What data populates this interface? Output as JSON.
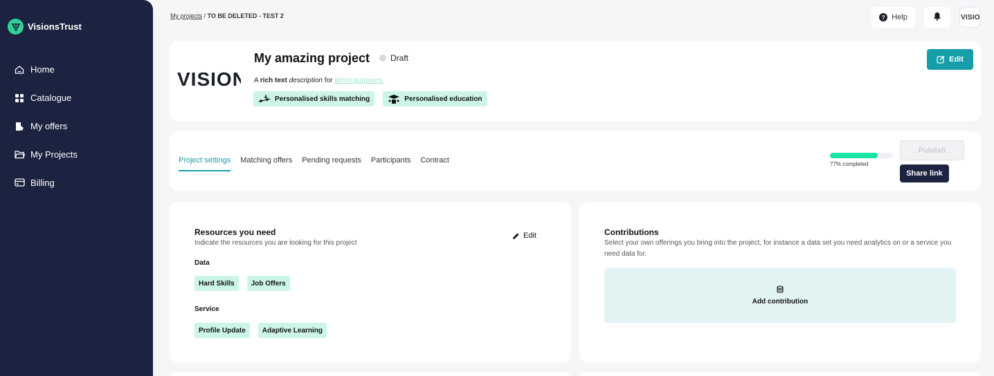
{
  "brand": {
    "name": "VisionsTrust"
  },
  "sidebar": {
    "items": [
      {
        "label": "Home",
        "icon": "home-icon"
      },
      {
        "label": "Catalogue",
        "icon": "grid-icon"
      },
      {
        "label": "My offers",
        "icon": "offers-icon"
      },
      {
        "label": "My Projects",
        "icon": "folder-icon"
      },
      {
        "label": "Billing",
        "icon": "billing-icon"
      }
    ]
  },
  "breadcrumb": {
    "parent": "My projects",
    "separator": "/",
    "current": "TO BE DELETED - TEST 2"
  },
  "topbar": {
    "help_label": "Help",
    "avatar_text": "VISIONS"
  },
  "project": {
    "logo_text": "VISIONS",
    "title": "My amazing project",
    "status": "Draft",
    "description": {
      "part1": "A ",
      "bold": "rich text",
      "italic": "description",
      "part2": " for ",
      "link": "demo purposes."
    },
    "tags": [
      {
        "label": "Personalised skills matching",
        "icon": "skills-matching-icon"
      },
      {
        "label": "Personalised education",
        "icon": "education-icon"
      }
    ],
    "edit_label": "Edit"
  },
  "tabs": {
    "items": [
      "Project settings",
      "Matching offers",
      "Pending requests",
      "Participants",
      "Contract"
    ],
    "active": 0
  },
  "progress": {
    "percent": 77,
    "label": "77% completed"
  },
  "actions": {
    "publish_label": "Publish",
    "share_label": "Share link"
  },
  "resources": {
    "title": "Resources you need",
    "subtitle": "Indicate the resources you are looking for this project",
    "edit_label": "Edit",
    "data_label": "Data",
    "data_items": [
      "Hard Skills",
      "Job Offers"
    ],
    "service_label": "Service",
    "service_items": [
      "Profile Update",
      "Adaptive Learning"
    ]
  },
  "contributions": {
    "title": "Contributions",
    "subtitle": "Select your own offerings you bring into the project, for instance a data set you need analytics on or a service you need data for.",
    "add_label": "Add contribution"
  },
  "colors": {
    "sidebar_bg": "#1c2340",
    "accent": "#159ea8",
    "progress": "#19e3a6",
    "chip_bg": "#ccf5e7",
    "contrib_bg": "#e2f3f3"
  }
}
